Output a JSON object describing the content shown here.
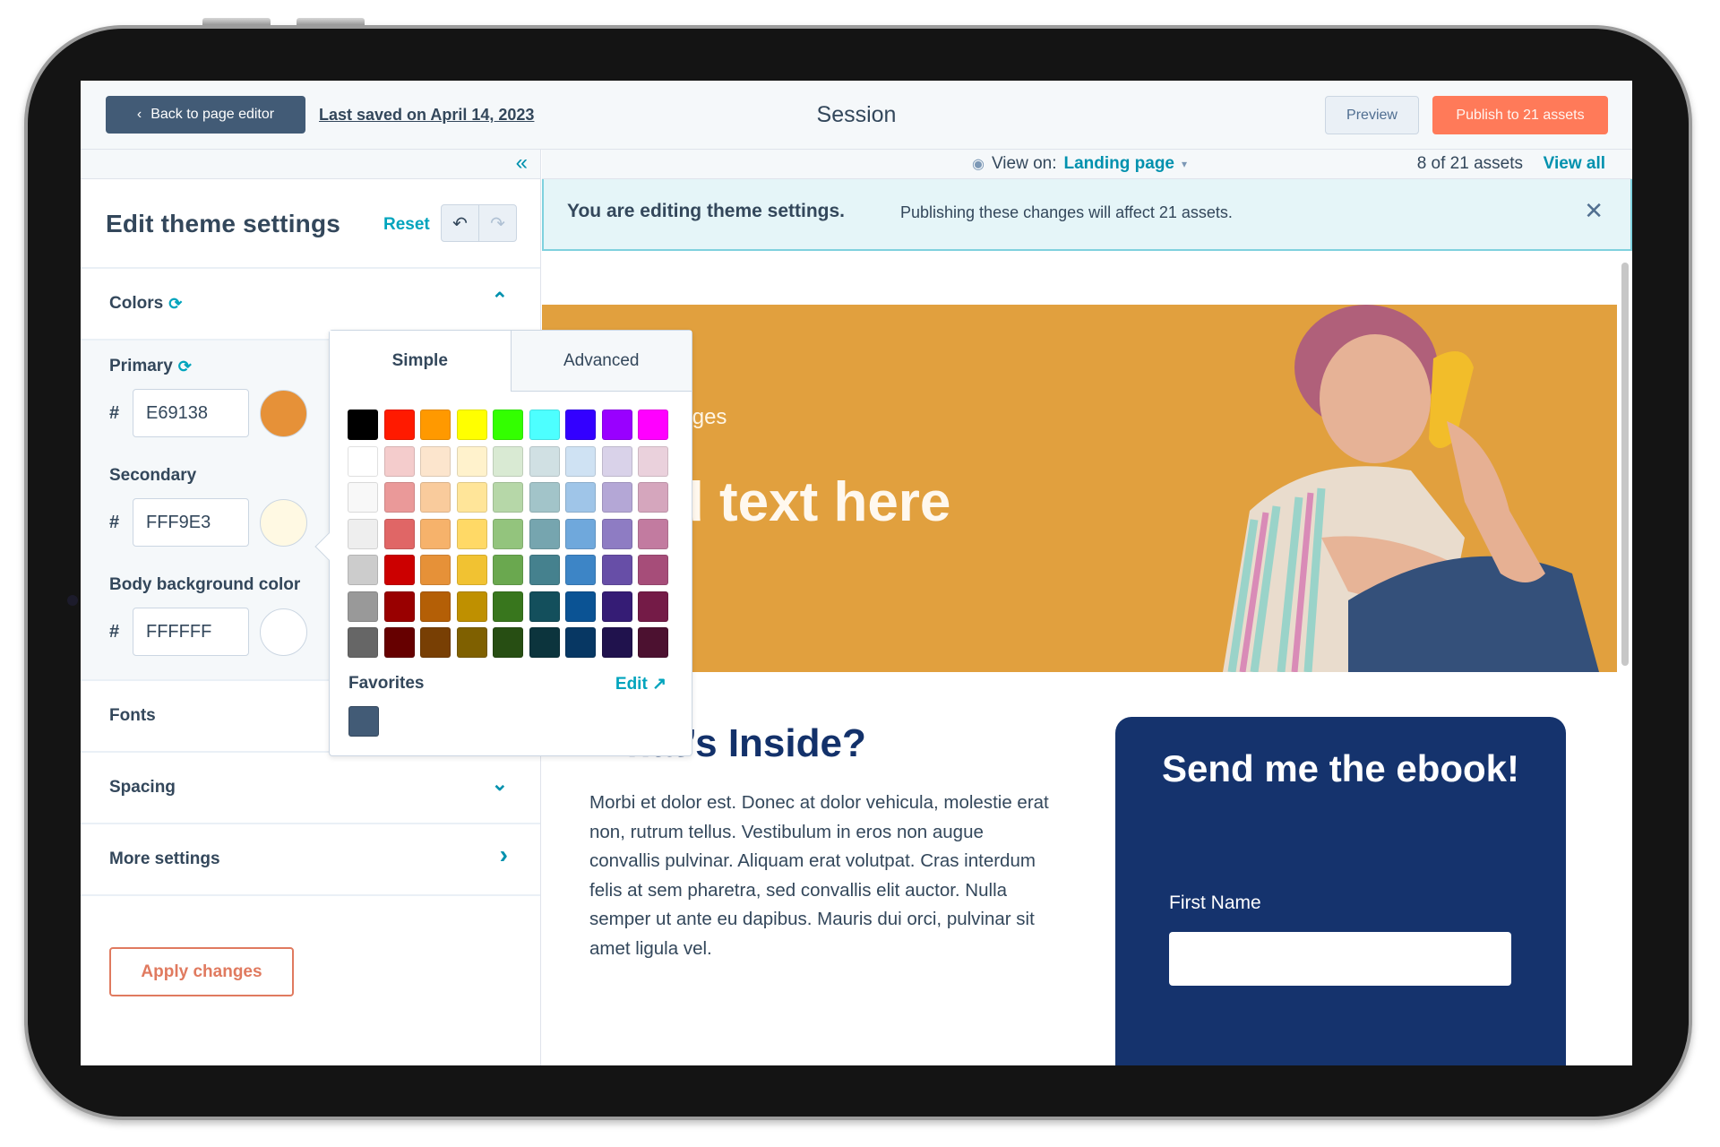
{
  "header": {
    "back_label": "Back to page editor",
    "last_saved": "Last saved on April 14, 2023",
    "page_name": "Session",
    "preview_label": "Preview",
    "publish_label": "Publish to 21 assets"
  },
  "sidebar": {
    "title": "Edit theme settings",
    "reset_label": "Reset",
    "sections": {
      "colors": "Colors",
      "fonts": "Fonts",
      "spacing": "Spacing",
      "more": "More settings"
    },
    "colors": [
      {
        "label": "Primary",
        "hex": "E69138",
        "swatch": "#E69138",
        "synced": true
      },
      {
        "label": "Secondary",
        "hex": "FFF9E3",
        "swatch": "#FFF9E3",
        "synced": false
      },
      {
        "label": "Body background color",
        "hex": "FFFFFF",
        "swatch": "#FFFFFF",
        "synced": false
      }
    ],
    "hash": "#",
    "apply_label": "Apply changes"
  },
  "picker": {
    "tabs": [
      "Simple",
      "Advanced"
    ],
    "active_tab": "Simple",
    "palette": [
      [
        "#000000",
        "#ff1a00",
        "#ff9900",
        "#ffff00",
        "#33ff00",
        "#4dffff",
        "#3300ff",
        "#9900ff",
        "#ff00ff"
      ],
      [
        "#ffffff",
        "#f4cccc",
        "#fce5cd",
        "#fff2cc",
        "#d9ead3",
        "#d0e0e3",
        "#cfe2f3",
        "#d9d2e9",
        "#ead1dc"
      ],
      [
        "#f8f8f8",
        "#ea9999",
        "#f9cb9c",
        "#ffe599",
        "#b6d7a8",
        "#a2c4c9",
        "#9fc5e8",
        "#b4a7d6",
        "#d5a6bd"
      ],
      [
        "#eeeeee",
        "#e06666",
        "#f6b26b",
        "#ffd966",
        "#93c47d",
        "#76a5af",
        "#6fa8dc",
        "#8e7cc3",
        "#c27ba0"
      ],
      [
        "#cccccc",
        "#cc0000",
        "#e69138",
        "#f1c232",
        "#6aa84f",
        "#45818e",
        "#3d85c6",
        "#674ea7",
        "#a64d79"
      ],
      [
        "#999999",
        "#990000",
        "#b45f06",
        "#bf9000",
        "#38761d",
        "#134f5c",
        "#0b5394",
        "#351c75",
        "#741b47"
      ],
      [
        "#666666",
        "#660000",
        "#783f04",
        "#7f6000",
        "#274e13",
        "#0c343d",
        "#073763",
        "#20124d",
        "#4c1130"
      ]
    ],
    "favorites_label": "Favorites",
    "edit_label": "Edit",
    "favorites": [
      "#425b76"
    ]
  },
  "main": {
    "view_on_label": "View on:",
    "view_on_value": "Landing page",
    "asset_count": "8 of 21 assets",
    "view_all": "View all",
    "banner_title": "You are editing theme settings.",
    "banner_text": "Publishing these changes will affect 21 assets.",
    "hero_eyebrow": "ng Pages",
    "hero_title": "dd text here",
    "section_title": "What’s Inside?",
    "section_body": "Morbi et dolor est. Donec at dolor vehicula, molestie erat non, rutrum tellus. Vestibulum in eros non augue convallis pulvinar. Aliquam erat volutpat. Cras interdum felis at sem pharetra, sed convallis elit auctor. Nulla semper ut ante eu dapibus. Mauris dui orci, pulvinar sit amet ligula vel.",
    "form_title": "Send me the ebook!",
    "form_field_label": "First Name",
    "form_field_value": ""
  },
  "icons": {
    "back": "‹",
    "collapse": "«",
    "undo": "↶",
    "redo": "↷",
    "sync": "⟳",
    "chevron_up": "⌃",
    "chevron_down": "⌄",
    "chevron_right": "›",
    "eye": "◉",
    "caret": "▾",
    "close": "✕",
    "external": "↗"
  },
  "colors": {
    "accent": "#00a4bd",
    "publish": "#ff7a59",
    "back_button": "#425b76",
    "hero_bg": "#e1a03e",
    "form_bg": "#15336d"
  }
}
